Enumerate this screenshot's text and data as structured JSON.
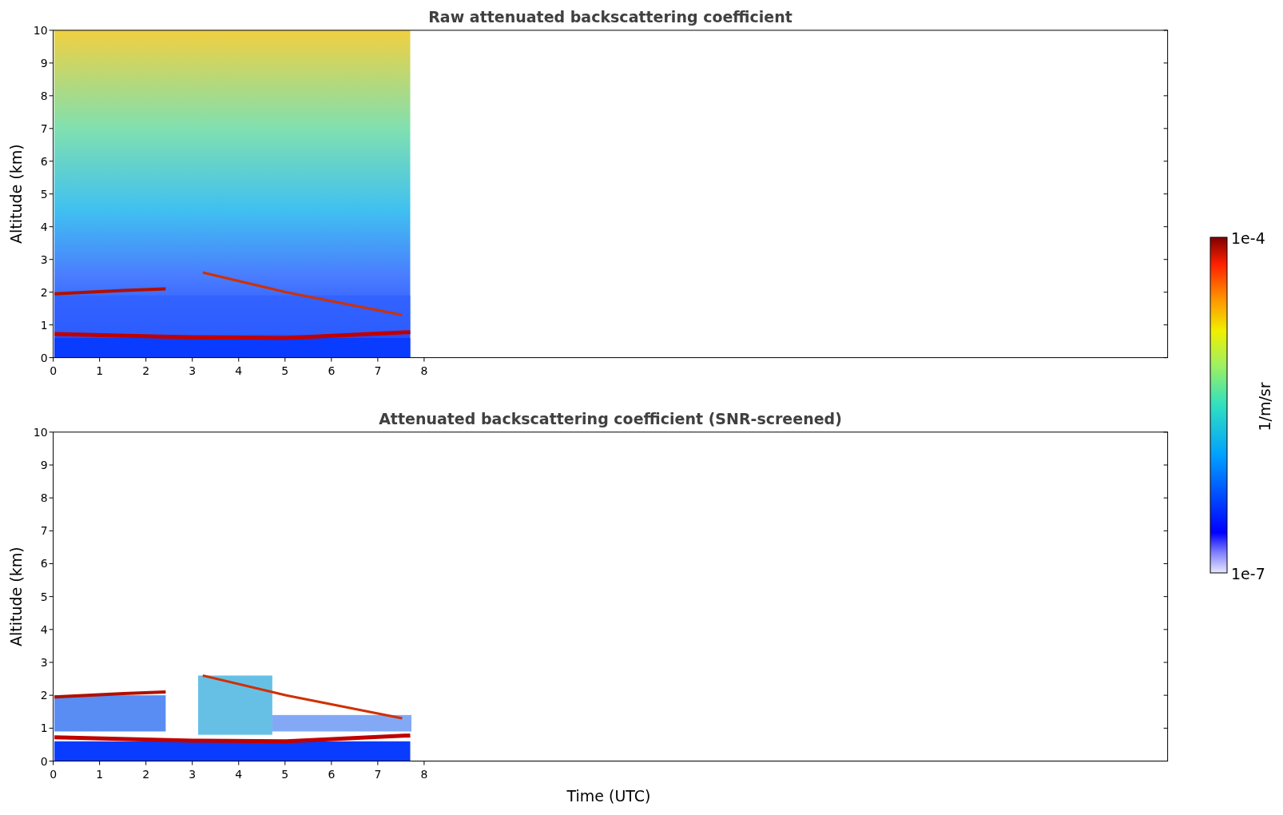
{
  "panels": [
    {
      "title": "Raw attenuated backscattering coefficient",
      "ylabel": "Altitude (km)",
      "kind": "raw",
      "yticks": [
        "10",
        "9",
        "8",
        "7",
        "6",
        "5",
        "4",
        "3",
        "2",
        "1",
        "0"
      ],
      "xticks": [
        "0",
        "1",
        "2",
        "3",
        "4",
        "5",
        "6",
        "7",
        "8"
      ]
    },
    {
      "title": "Attenuated backscattering coefficient (SNR-screened)",
      "ylabel": "Altitude (km)",
      "kind": "screened",
      "yticks": [
        "10",
        "9",
        "8",
        "7",
        "6",
        "5",
        "4",
        "3",
        "2",
        "1",
        "0"
      ],
      "xticks": [
        "0",
        "1",
        "2",
        "3",
        "4",
        "5",
        "6",
        "7",
        "8"
      ]
    }
  ],
  "xlabel": "Time (UTC)",
  "colorbar": {
    "max": "1e-4",
    "min": "1e-7",
    "label": "1/m/sr"
  }
}
